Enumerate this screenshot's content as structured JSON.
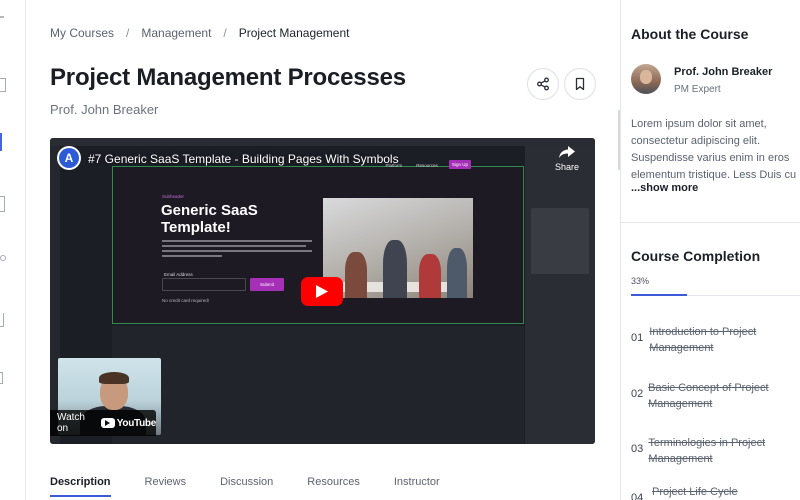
{
  "breadcrumb": {
    "items": [
      "My Courses",
      "Management",
      "Project Management"
    ],
    "separator": "/"
  },
  "course": {
    "title": "Project Management Processes",
    "author": "Prof. John Breaker"
  },
  "actions": {
    "share_icon": "share-icon",
    "bookmark_icon": "bookmark-icon"
  },
  "video": {
    "title": "#7 Generic SaaS Template - Building Pages With Symbols",
    "channel_initial": "A",
    "share_label": "Share",
    "watch_on_label": "Watch on",
    "youtube_label": "YouTube",
    "embedded": {
      "nav": [
        "Platform",
        "Resources",
        "Log in"
      ],
      "signup": "Sign Up",
      "subheader": "Subheader",
      "hero_title": "Generic SaaS Template!",
      "email_label": "Email Address",
      "submit": "Submit",
      "note": "No credit card required!"
    }
  },
  "tabs": [
    "Description",
    "Reviews",
    "Discussion",
    "Resources",
    "Instructor"
  ],
  "active_tab": "Description",
  "about": {
    "title": "About the Course",
    "instructor_name": "Prof. John Breaker",
    "instructor_role": "PM Expert",
    "text": "Lorem ipsum dolor sit amet, consectetur adipiscing elit. Suspendisse varius enim in eros elementum tristique. Less Duis cu",
    "show_more": "...show more"
  },
  "completion": {
    "title": "Course Completion",
    "percent_label": "33%",
    "percent": 33,
    "lessons": [
      {
        "num": "01",
        "title": "Introduction to Project Management",
        "done": true
      },
      {
        "num": "02",
        "title": "Basic Concept of Project Management",
        "done": true
      },
      {
        "num": "03",
        "title": "Terminologies in Project Management",
        "done": true
      },
      {
        "num": "04",
        "title": "Project Life Cycle",
        "done": true
      }
    ]
  },
  "colors": {
    "accent": "#3b5bdb",
    "youtube_red": "#ff0000",
    "text_dark": "#1b1f27"
  }
}
